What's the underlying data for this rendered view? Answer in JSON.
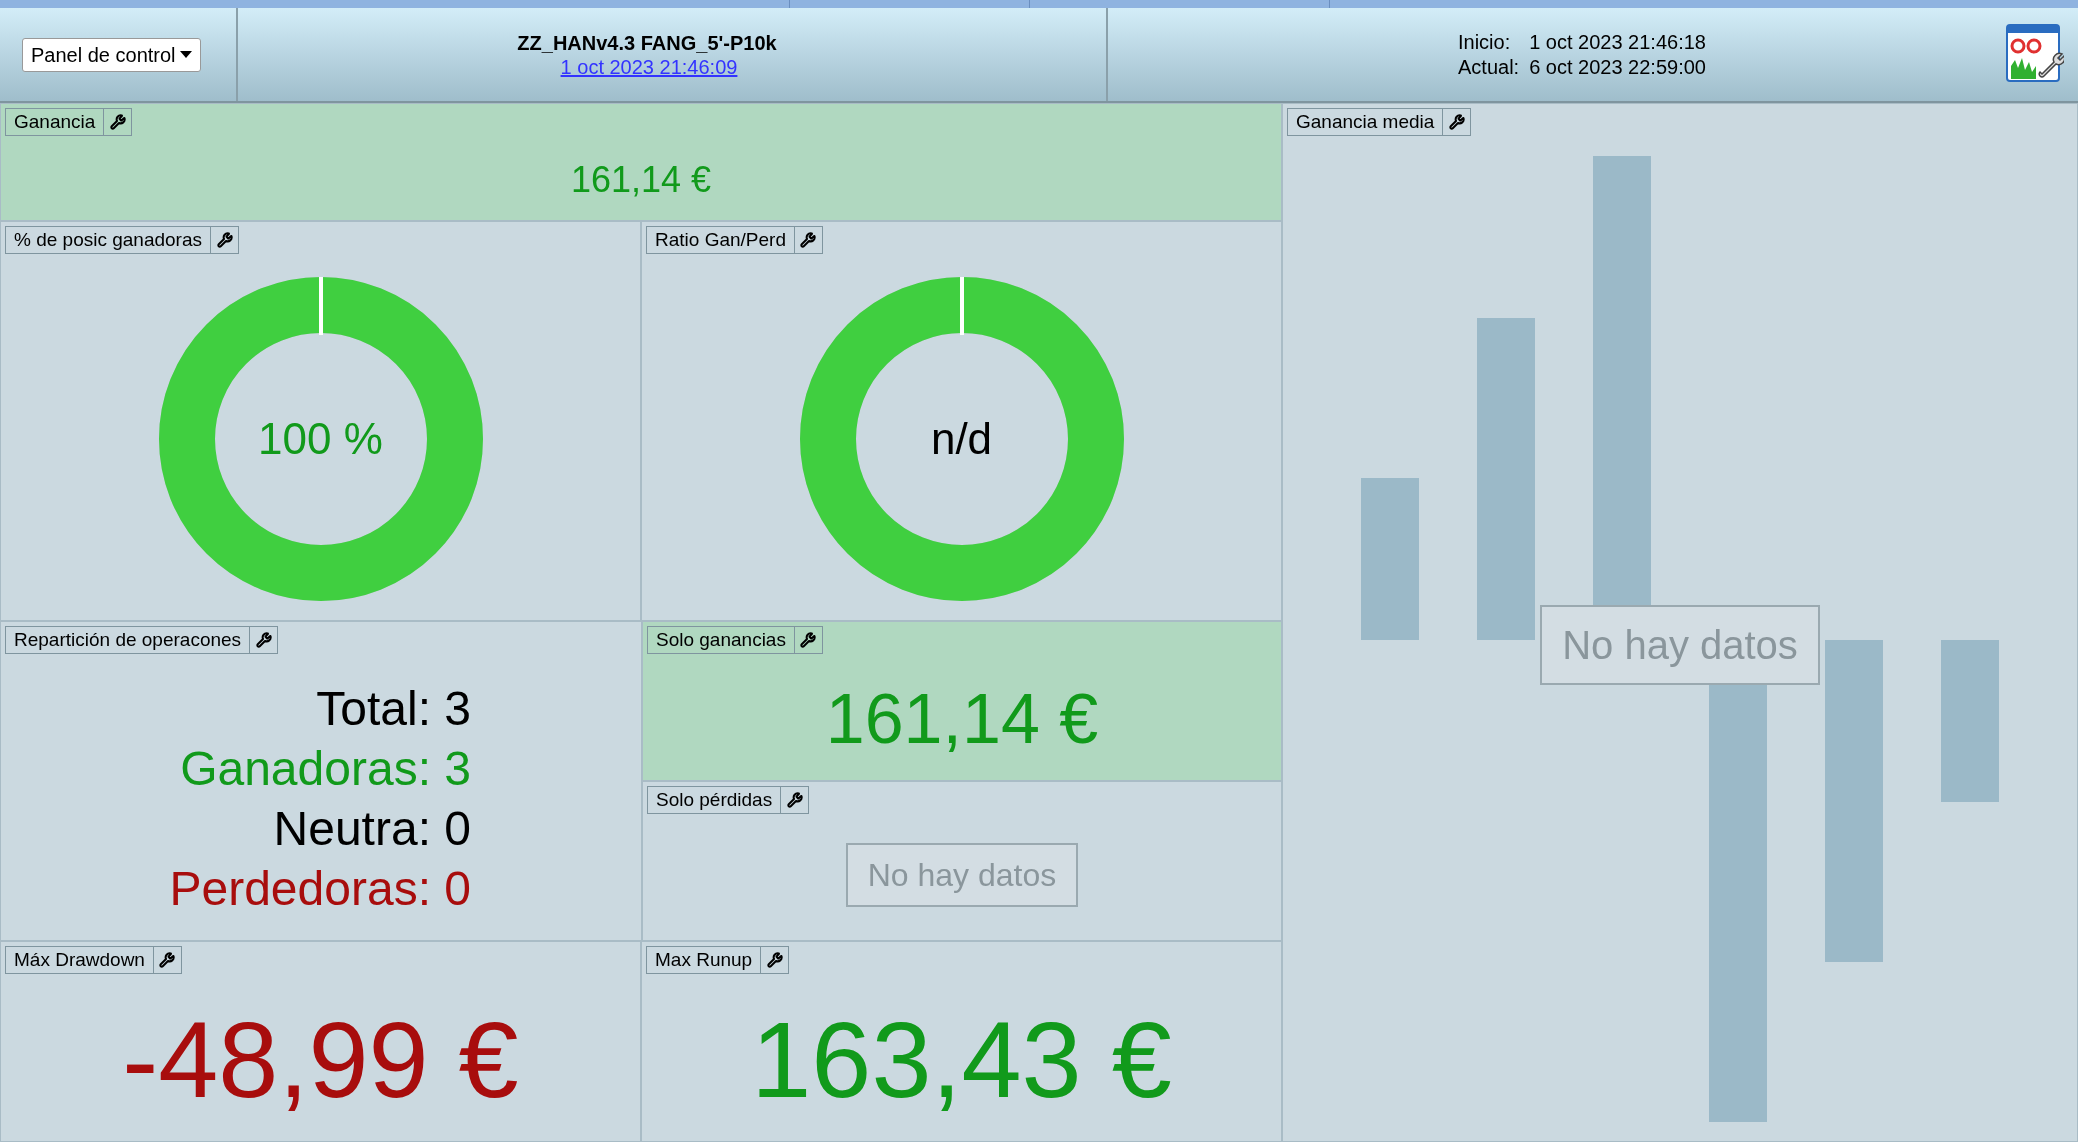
{
  "header": {
    "menu_button": "Panel de control",
    "title": "ZZ_HANv4.3 FANG_5'-P10k",
    "date_link": "1 oct 2023 21:46:09",
    "start_label": "Inicio:",
    "start_value": "1 oct 2023 21:46:18",
    "current_label": "Actual:",
    "current_value": "6 oct 2023 22:59:00"
  },
  "panels": [
    {
      "kind": "value",
      "title": "Ganancia",
      "value": "161,14 €",
      "color": "#119a1b",
      "highlighted": true
    },
    {
      "kind": "donut",
      "title": "% de posic ganadoras",
      "value": "100 %",
      "color": "#119a1b",
      "level": 1
    },
    {
      "kind": "donut",
      "title": "Ratio Gan/Perd",
      "value": "n/d",
      "color": "#000000",
      "level": 1
    },
    {
      "kind": "breakdown",
      "title": "Repartición de operacones",
      "lines": [
        {
          "text": "Total: 3",
          "color": "#000000"
        },
        {
          "text": "Ganadoras: 3",
          "color": "#119a1b"
        },
        {
          "text": "Neutra: 0",
          "color": "#000000"
        },
        {
          "text": "Perdedoras: 0",
          "color": "#a80d0d"
        }
      ]
    },
    {
      "kind": "value",
      "title": "Solo ganancias",
      "value": "161,14 €",
      "color": "#119a1b",
      "highlighted": true
    },
    {
      "kind": "empty",
      "title": "Solo pérdidas",
      "message": "No hay datos"
    },
    {
      "kind": "value",
      "title": "Máx Drawdown",
      "value": "-48,99 €",
      "color": "#a80d0d",
      "highlighted": false
    },
    {
      "kind": "value",
      "title": "Max Runup",
      "value": "163,43 €",
      "color": "#119a1b",
      "highlighted": false
    },
    {
      "kind": "bars",
      "title": "Ganancia media",
      "message": "No hay datos"
    }
  ]
}
